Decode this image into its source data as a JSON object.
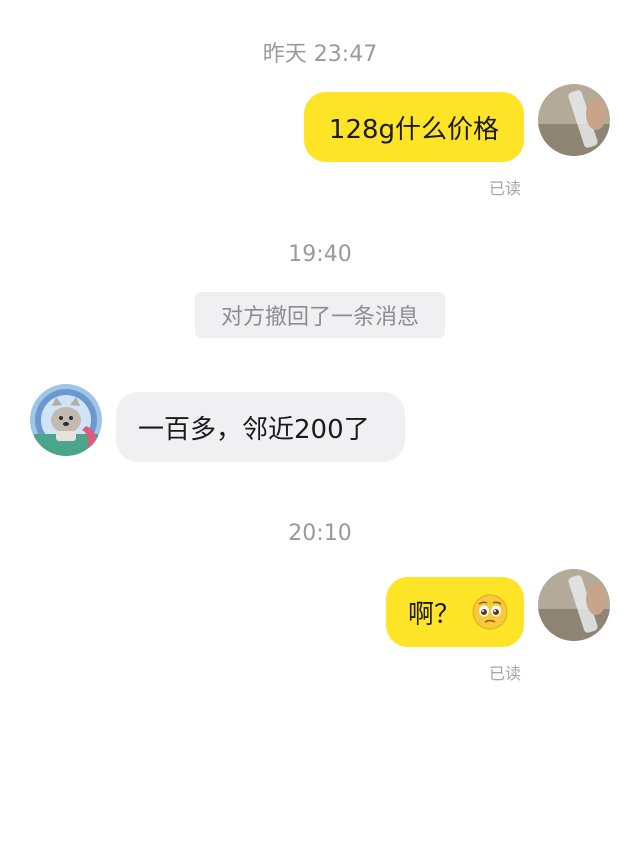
{
  "timestamps": {
    "t1": "昨天 23:47",
    "t2": "19:40",
    "t3": "20:10"
  },
  "messages": [
    {
      "from": "me",
      "text": "128g什么价格",
      "status": "已读"
    },
    {
      "from": "system",
      "text": "对方撤回了一条消息"
    },
    {
      "from": "them",
      "text": "一百多，邻近200了"
    },
    {
      "from": "me",
      "text": "啊？",
      "emoji": "pleading-face-icon",
      "status": "已读"
    }
  ],
  "colors": {
    "my_bubble": "#fde427",
    "their_bubble": "#f0f0f2",
    "timestamp": "#9a9a9a",
    "status": "#a6a6a6"
  }
}
